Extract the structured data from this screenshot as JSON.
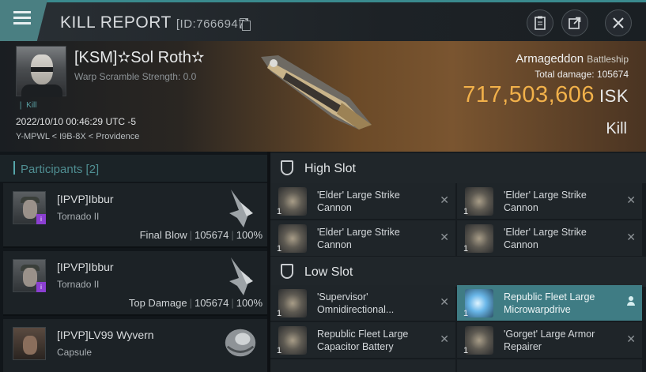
{
  "titlebar": {
    "title": "KILL REPORT",
    "report_id": "[ID:7666947]",
    "icons": [
      "menu-icon",
      "copy-icon",
      "clipboard-icon",
      "share-icon",
      "close-icon"
    ]
  },
  "victim": {
    "name": "[KSM]✫Sol Roth✫",
    "subtitle": "Warp Scramble Strength: 0.0",
    "corp_tag": "❘ Kill",
    "datetime": "2022/10/10 00:46:29 UTC -5",
    "location": "Y-MPWL < I9B-8X < Providence",
    "ship_name": "Armageddon",
    "ship_class": "Battleship",
    "total_damage_label": "Total damage:",
    "total_damage": "105674",
    "isk_value": "717,503,606",
    "isk_unit": "ISK",
    "result": "Kill"
  },
  "participants": {
    "header": "Participants [2]",
    "rows": [
      {
        "name": "[IPVP]Ibbur",
        "ship": "Tornado II",
        "role": "Final Blow",
        "damage": "105674",
        "percent": "100%"
      },
      {
        "name": "[IPVP]Ibbur",
        "ship": "Tornado II",
        "role": "Top Damage",
        "damage": "105674",
        "percent": "100%"
      },
      {
        "name": "[IPVP]LV99 Wyvern",
        "ship": "Capsule",
        "role": "",
        "damage": "",
        "percent": ""
      }
    ]
  },
  "slots": {
    "high": {
      "label": "High Slot",
      "modules": [
        {
          "qty": "1",
          "name": "'Elder' Large Strike Cannon"
        },
        {
          "qty": "1",
          "name": "'Elder' Large Strike Cannon"
        },
        {
          "qty": "1",
          "name": "'Elder' Large Strike Cannon"
        },
        {
          "qty": "1",
          "name": "'Elder' Large Strike Cannon"
        }
      ]
    },
    "low": {
      "label": "Low Slot",
      "modules": [
        {
          "qty": "1",
          "name": "'Supervisor' Omnidirectional..."
        },
        {
          "qty": "1",
          "name": "Republic Fleet Large Microwarpdrive"
        },
        {
          "qty": "1",
          "name": "Republic Fleet Large Capacitor Battery"
        },
        {
          "qty": "1",
          "name": "'Gorget' Large Armor Repairer"
        }
      ]
    }
  },
  "colors": {
    "accent": "#56a6aa",
    "isk": "#f2b14a",
    "highlight": "#3f7c84",
    "rookie_badge": "#8b3fd1"
  }
}
